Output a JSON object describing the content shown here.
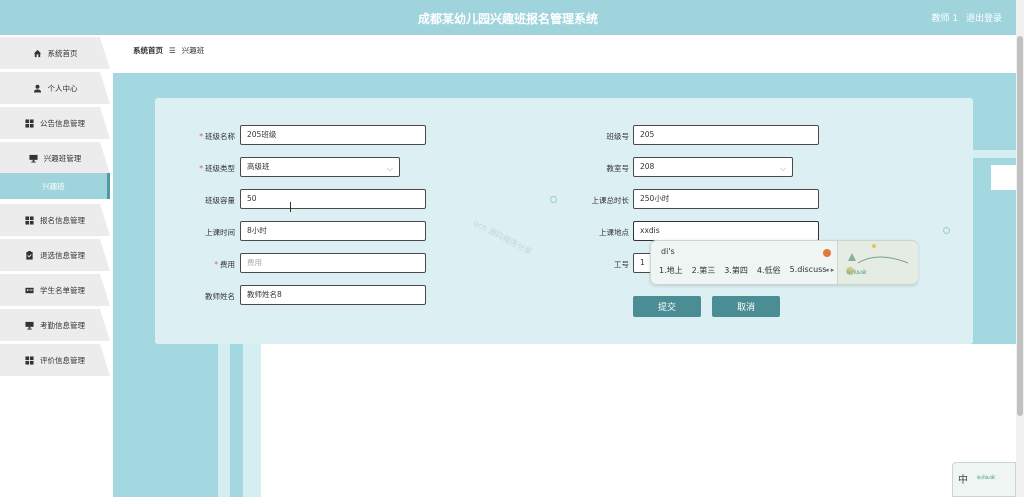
{
  "header": {
    "title": "成都某幼儿园兴趣班报名管理系统",
    "user": "教师 1",
    "logout": "退出登录"
  },
  "sidebar": {
    "items": [
      {
        "label": "系统首页",
        "icon": "home-icon"
      },
      {
        "label": "个人中心",
        "icon": "user-icon"
      },
      {
        "label": "公告信息管理",
        "icon": "grid-icon"
      },
      {
        "label": "兴趣班管理",
        "icon": "monitor-icon"
      },
      {
        "label": "兴趣班",
        "icon": ""
      },
      {
        "label": "报名信息管理",
        "icon": "grid-icon"
      },
      {
        "label": "退选信息管理",
        "icon": "clipboard-icon"
      },
      {
        "label": "学生名单管理",
        "icon": "id-card-icon"
      },
      {
        "label": "考勤信息管理",
        "icon": "monitor-icon"
      },
      {
        "label": "评价信息管理",
        "icon": "grid-icon"
      }
    ]
  },
  "breadcrumb": {
    "home": "系统首页",
    "separator": "☰",
    "current": "兴趣班"
  },
  "form": {
    "class_name_label": "班级名称",
    "class_name_value": "205班级",
    "class_no_label": "班级号",
    "class_no_value": "205",
    "class_type_label": "班级类型",
    "class_type_value": "高级班",
    "room_label": "教室号",
    "room_value": "208",
    "capacity_label": "班级容量",
    "capacity_value": "50",
    "total_hours_label": "上课总时长",
    "total_hours_value": "250小时",
    "time_label": "上课时间",
    "time_value": "8小时",
    "place_label": "上课地点",
    "place_value": "xxdis",
    "fee_label": "费用",
    "fee_placeholder": "费用",
    "staff_no_label": "工号",
    "staff_no_value": "1",
    "teacher_label": "教师姓名",
    "teacher_value": "教师姓名8",
    "submit": "提交",
    "cancel": "取消"
  },
  "ime": {
    "composition": "di's",
    "candidates": [
      "1.地上",
      "2.第三",
      "3.第四",
      "4.低俗",
      "5.discuss"
    ],
    "nav": "◂ ▸",
    "art_text": "ꞩ꩸ꦦꦗꦁ",
    "mini_label": "中"
  },
  "watermark": "qcn 源码程序分享"
}
